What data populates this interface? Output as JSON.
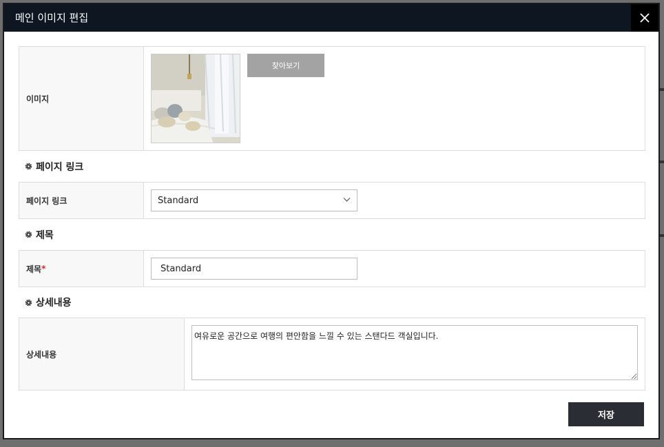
{
  "modal": {
    "title": "메인 이미지 편집"
  },
  "image_row": {
    "label": "이미지",
    "browse_label": "찾아보기"
  },
  "page_link_section": {
    "title": "페이지 링크",
    "label": "페이지 링크",
    "selected": "Standard"
  },
  "title_section": {
    "title": "제목",
    "label": "제목",
    "required_mark": "*",
    "value": "Standard"
  },
  "detail_section": {
    "title": "상세내용",
    "label": "상세내용",
    "value": "여유로운 공간으로 여행의 편안함을 느낄 수 있는 스탠다드 객실입니다."
  },
  "save_label": "저장",
  "icons": {
    "close": "close-icon",
    "section": "gear-icon",
    "dropdown": "chevron-down-icon"
  },
  "colors": {
    "header_bg": "#0e1621",
    "save_bg": "#2b2d34",
    "browse_bg": "#a3a3a3",
    "required": "#e0202c"
  }
}
